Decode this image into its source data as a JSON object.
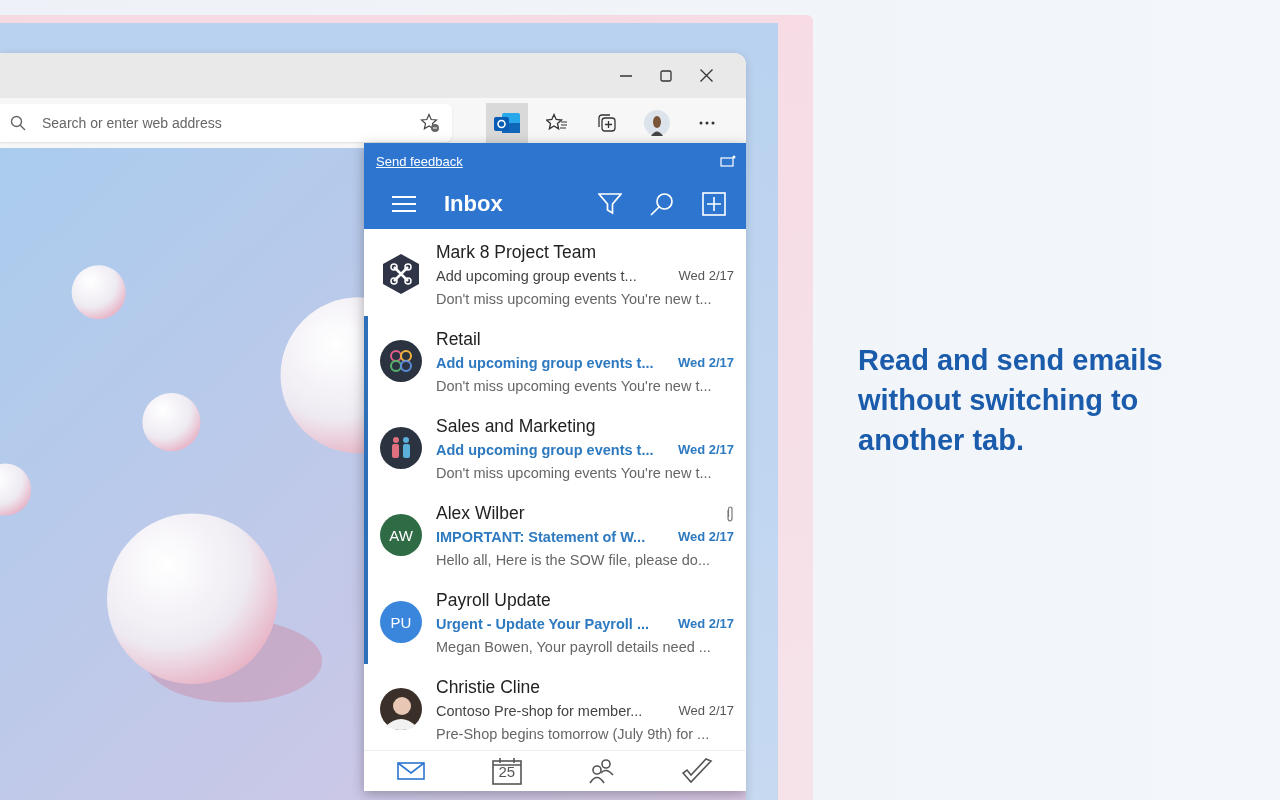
{
  "browser": {
    "address_bar": {
      "placeholder": "Search or enter web address"
    },
    "extension_active": true
  },
  "popup": {
    "feedback_link": "Send feedback",
    "title": "Inbox",
    "messages": [
      {
        "sender": "Mark 8 Project Team",
        "subject": "Add upcoming group events t...",
        "date": "Wed 2/17",
        "preview": "Don't miss upcoming events You're new t...",
        "unread": false,
        "attachment": false,
        "avatar": {
          "kind": "hexagon"
        }
      },
      {
        "sender": "Retail",
        "subject": "Add upcoming group events t...",
        "date": "Wed 2/17",
        "preview": "Don't miss upcoming events You're new t...",
        "unread": true,
        "attachment": false,
        "avatar": {
          "kind": "knot"
        }
      },
      {
        "sender": "Sales and Marketing",
        "subject": "Add upcoming group events t...",
        "date": "Wed 2/17",
        "preview": "Don't miss upcoming events You're new t...",
        "unread": true,
        "attachment": false,
        "avatar": {
          "kind": "people"
        }
      },
      {
        "sender": "Alex Wilber",
        "subject": "IMPORTANT: Statement of W...",
        "date": "Wed 2/17",
        "preview": "Hello all, Here is the SOW file, please do...",
        "unread": true,
        "attachment": true,
        "avatar": {
          "kind": "initials",
          "text": "AW",
          "color": "#2f6b45"
        }
      },
      {
        "sender": "Payroll Update",
        "subject": "Urgent - Update Your Payroll ...",
        "date": "Wed 2/17",
        "preview": "Megan Bowen, Your payroll details need ...",
        "unread": true,
        "attachment": false,
        "avatar": {
          "kind": "initials",
          "text": "PU",
          "color": "#3b86dd"
        }
      },
      {
        "sender": "Christie Cline",
        "subject": "Contoso Pre-shop for member...",
        "date": "Wed 2/17",
        "preview": "Pre-Shop begins tomorrow (July 9th) for ...",
        "unread": false,
        "attachment": false
      }
    ],
    "nav": [
      {
        "kind": "mail",
        "selected": true
      },
      {
        "kind": "calendar",
        "text": "25",
        "selected": false
      },
      {
        "kind": "people",
        "selected": false
      },
      {
        "kind": "tasks",
        "selected": false
      }
    ]
  },
  "headline": "Read and send emails without switching to another tab."
}
